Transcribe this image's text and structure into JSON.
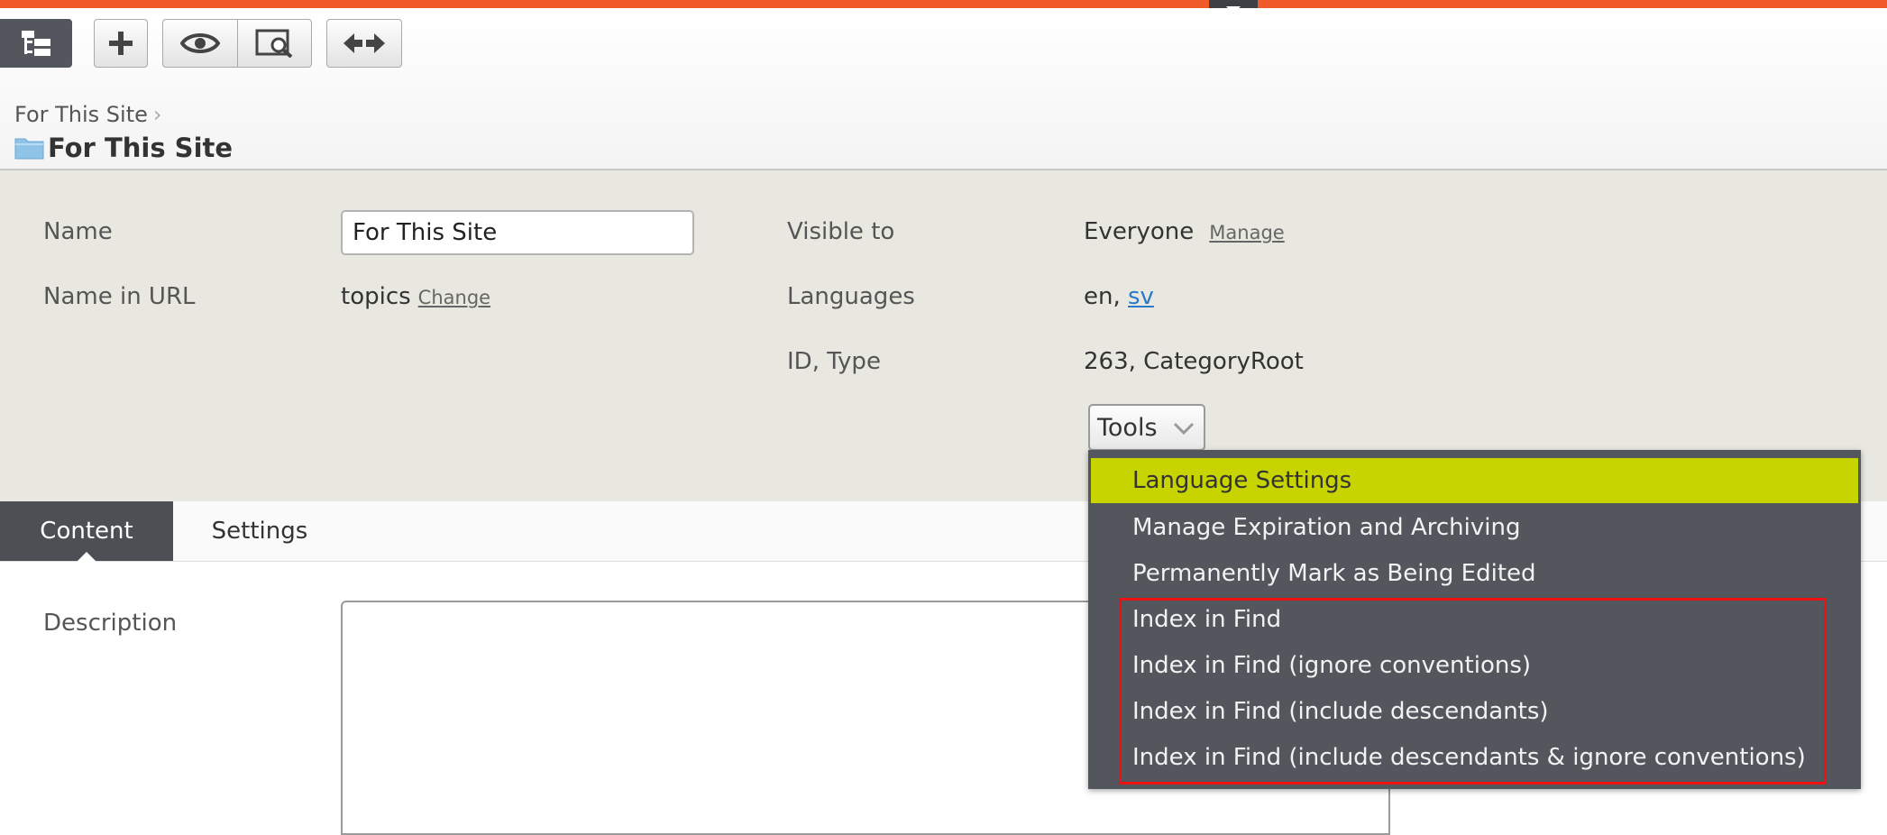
{
  "toolbar": {
    "tree_icon": "tree-structure-icon",
    "add_icon": "plus-icon",
    "preview_icon": "eye-icon",
    "compare_icon": "preview-search-icon",
    "expand_icon": "expand-arrows-icon"
  },
  "breadcrumb": {
    "item": "For This Site"
  },
  "page_title": "For This Site",
  "properties": {
    "name_label": "Name",
    "name_value": "For This Site",
    "name_in_url_label": "Name in URL",
    "name_in_url_value": "topics",
    "change_link": "Change",
    "visible_to_label": "Visible to",
    "visible_to_value": "Everyone",
    "manage_link": "Manage",
    "languages_label": "Languages",
    "languages_current": "en,",
    "languages_other": "sv",
    "id_type_label": "ID, Type",
    "id_type_value": "263, CategoryRoot"
  },
  "tools": {
    "label": "Tools",
    "menu_items": [
      "Language Settings",
      "Manage Expiration and Archiving",
      "Permanently Mark as Being Edited",
      "Index in Find",
      "Index in Find (ignore conventions)",
      "Index in Find (include descendants)",
      "Index in Find (include descendants & ignore conventions)"
    ],
    "highlighted_index": 0
  },
  "tabs": [
    {
      "label": "Content",
      "active": true
    },
    {
      "label": "Settings",
      "active": false
    }
  ],
  "content": {
    "description_label": "Description"
  },
  "colors": {
    "accent_bar": "#f05a28",
    "menu_bg": "#53575d",
    "menu_highlight": "#c8d400",
    "annotation_box": "#ee1111",
    "props_bg": "#e8e8e1"
  }
}
